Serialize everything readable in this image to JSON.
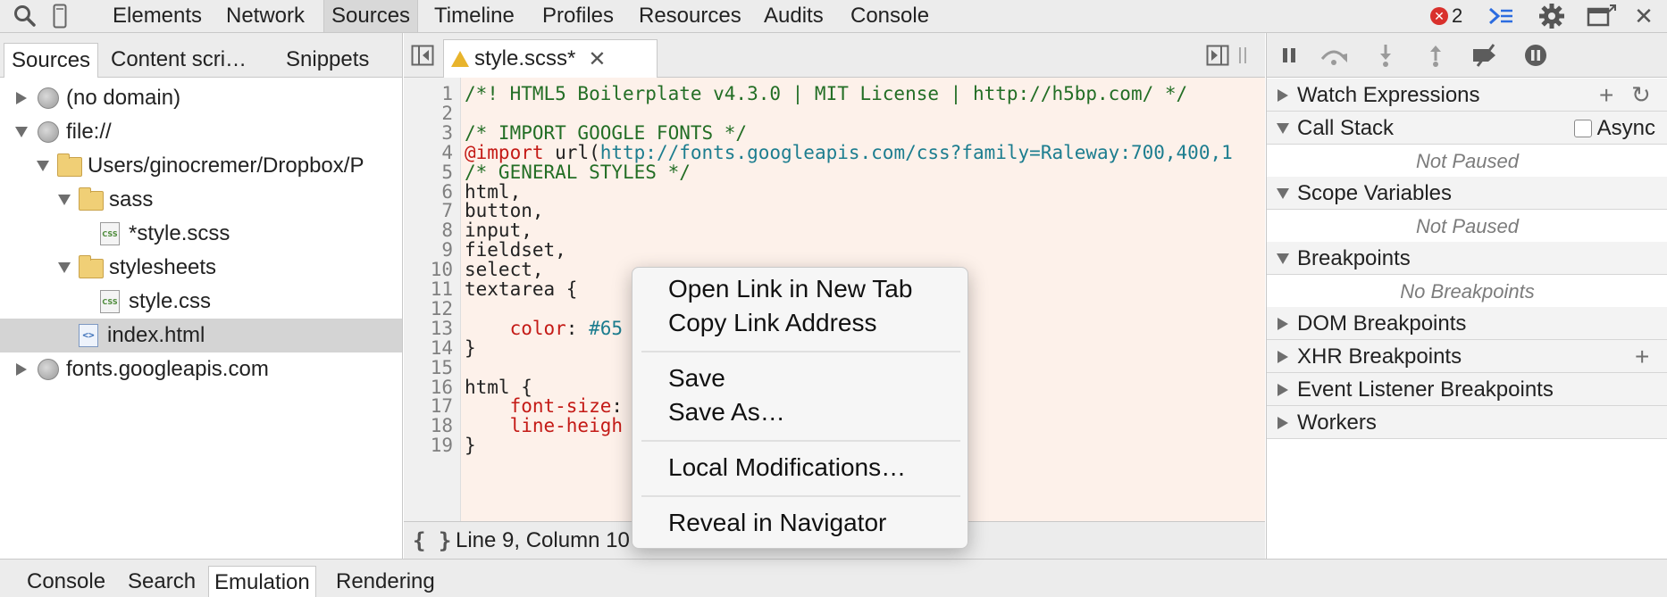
{
  "toolbar": {
    "tabs": [
      "Elements",
      "Network",
      "Sources",
      "Timeline",
      "Profiles",
      "Resources",
      "Audits",
      "Console"
    ],
    "active_tab": "Sources",
    "error_count": "2",
    "icons": [
      "search-icon",
      "device-mode-icon",
      "console-drawer-icon",
      "gear-icon",
      "dock-icon",
      "close-icon"
    ]
  },
  "navigator": {
    "tabs": [
      "Sources",
      "Content scri…",
      "Snippets"
    ],
    "tree": [
      {
        "label": "(no domain)",
        "icon": "globe-icon",
        "expanded": false
      },
      {
        "label": "file://",
        "icon": "globe-icon",
        "expanded": true
      },
      {
        "label": "Users/ginocremer/Dropbox/P",
        "icon": "folder-icon",
        "expanded": true
      },
      {
        "label": "sass",
        "icon": "folder-icon",
        "expanded": true
      },
      {
        "label": "*style.scss",
        "icon": "css-file-icon"
      },
      {
        "label": "stylesheets",
        "icon": "folder-icon",
        "expanded": true
      },
      {
        "label": "style.css",
        "icon": "css-file-icon"
      },
      {
        "label": "index.html",
        "icon": "html-file-icon",
        "selected": true
      },
      {
        "label": "fonts.googleapis.com",
        "icon": "globe-icon",
        "expanded": false
      }
    ]
  },
  "editor": {
    "tab_label": "style.scss*",
    "lines": [
      {
        "n": "1",
        "text": "/*! HTML5 Boilerplate v4.3.0 | MIT License | http://h5bp.com/ */"
      },
      {
        "n": "2",
        "text": ""
      },
      {
        "n": "3",
        "text": "/* IMPORT GOOGLE FONTS */"
      },
      {
        "n": "4",
        "at": "@import",
        "mid": " url(",
        "url": "http://fonts.googleapis.com/css?family=Raleway:700,400,1"
      },
      {
        "n": "5",
        "text": "/* GENERAL STYLES */"
      },
      {
        "n": "6",
        "text": "html,"
      },
      {
        "n": "7",
        "text": "button,"
      },
      {
        "n": "8",
        "text": "input,"
      },
      {
        "n": "9",
        "text": "fieldset,"
      },
      {
        "n": "10",
        "text": "select,"
      },
      {
        "n": "11",
        "text": "textarea {"
      },
      {
        "n": "12",
        "text": ""
      },
      {
        "n": "13",
        "prop": "    color",
        "sep": ": ",
        "val": "#65"
      },
      {
        "n": "14",
        "text": "}"
      },
      {
        "n": "15",
        "text": ""
      },
      {
        "n": "16",
        "text": "html {"
      },
      {
        "n": "17",
        "prop": "    font-size",
        "sep": ":",
        "val": ""
      },
      {
        "n": "18",
        "prop": "    line-heigh",
        "sep": "",
        "val": ""
      },
      {
        "n": "19",
        "text": "}"
      }
    ],
    "status": "Line 9, Column 10",
    "pretty_print": "{ }"
  },
  "debugger": {
    "panes": [
      {
        "title": "Watch Expressions",
        "expanded": false
      },
      {
        "title": "Call Stack",
        "expanded": true,
        "body": "Not Paused",
        "async_label": "Async"
      },
      {
        "title": "Scope Variables",
        "expanded": true,
        "body": "Not Paused"
      },
      {
        "title": "Breakpoints",
        "expanded": true,
        "body": "No Breakpoints"
      },
      {
        "title": "DOM Breakpoints",
        "expanded": false
      },
      {
        "title": "XHR Breakpoints",
        "expanded": false
      },
      {
        "title": "Event Listener Breakpoints",
        "expanded": false
      },
      {
        "title": "Workers",
        "expanded": false
      }
    ]
  },
  "drawer": {
    "tabs": [
      "Console",
      "Search",
      "Emulation",
      "Rendering"
    ],
    "active_tab": "Emulation"
  },
  "context_menu": {
    "items": [
      "Open Link in New Tab",
      "Copy Link Address",
      "Save",
      "Save As…",
      "Local Modifications…",
      "Reveal in Navigator"
    ]
  },
  "colors": {
    "comment": "#236e25",
    "at_rule": "#c41a16",
    "url": "#1c7d8f",
    "editor_bg": "#fdf1ea",
    "error_badge": "#d9302c",
    "warning": "#e8b42c"
  }
}
